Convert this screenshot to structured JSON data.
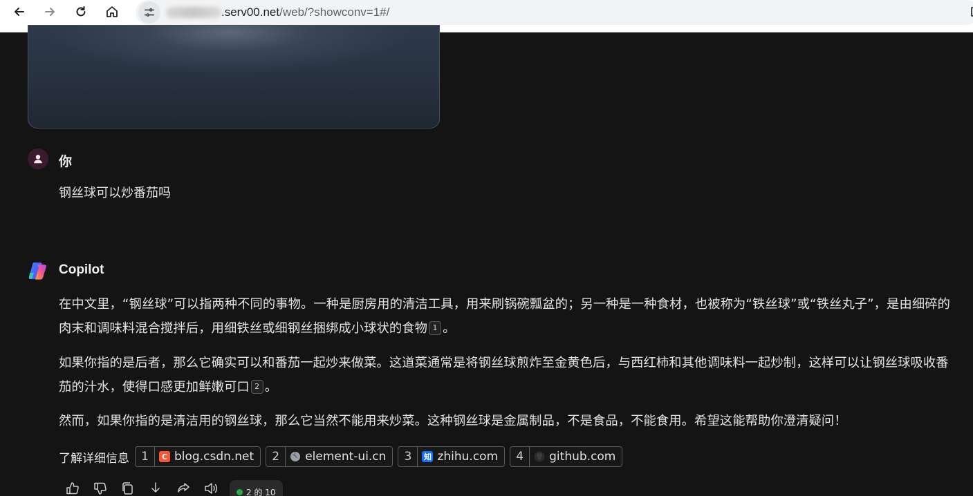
{
  "browser": {
    "url_host": ".serv00.net",
    "url_path": "/web/?showconv=1#/"
  },
  "user_message": {
    "sender": "你",
    "text": "钢丝球可以炒番茄吗"
  },
  "assistant_message": {
    "sender": "Copilot",
    "para1_text": "在中文里，“钢丝球”可以指两种不同的事物。一种是厨房用的清洁工具，用来刷锅碗瓢盆的；另一种是一种食材，也被称为“铁丝球”或“铁丝丸子”，是由细碎的肉末和调味料混合搅拌后，用细铁丝或细钢丝捆绑成小球状的食物",
    "para1_cite": "1",
    "para1_end": "。",
    "para2_text": "如果你指的是后者，那么它确实可以和番茄一起炒来做菜。这道菜通常是将钢丝球煎炸至金黄色后，与西红柿和其他调味料一起炒制，这样可以让钢丝球吸收番茄的汁水，使得口感更加鲜嫩可口",
    "para2_cite": "2",
    "para2_end": "。",
    "para3_text": "然而，如果你指的是清洁用的钢丝球，那么它当然不能用来炒菜。这种钢丝球是金属制品，不是食品，不能食用。希望这能帮助你澄清疑问！"
  },
  "sources": {
    "label": "了解详细信息",
    "items": [
      {
        "num": "1",
        "site": "blog.csdn.net",
        "icon": "csdn-icon",
        "icon_text": "C",
        "color": "#fc5531"
      },
      {
        "num": "2",
        "site": "element-ui.cn",
        "icon": "globe-icon",
        "icon_text": "",
        "color": "#9aa0a6"
      },
      {
        "num": "3",
        "site": "zhihu.com",
        "icon": "zhihu-icon",
        "icon_text": "知",
        "color": "#1772f6"
      },
      {
        "num": "4",
        "site": "github.com",
        "icon": "github-icon",
        "icon_text": "",
        "color": "#333333"
      }
    ]
  },
  "response_footer": {
    "page_indicator": "2 的 10"
  }
}
